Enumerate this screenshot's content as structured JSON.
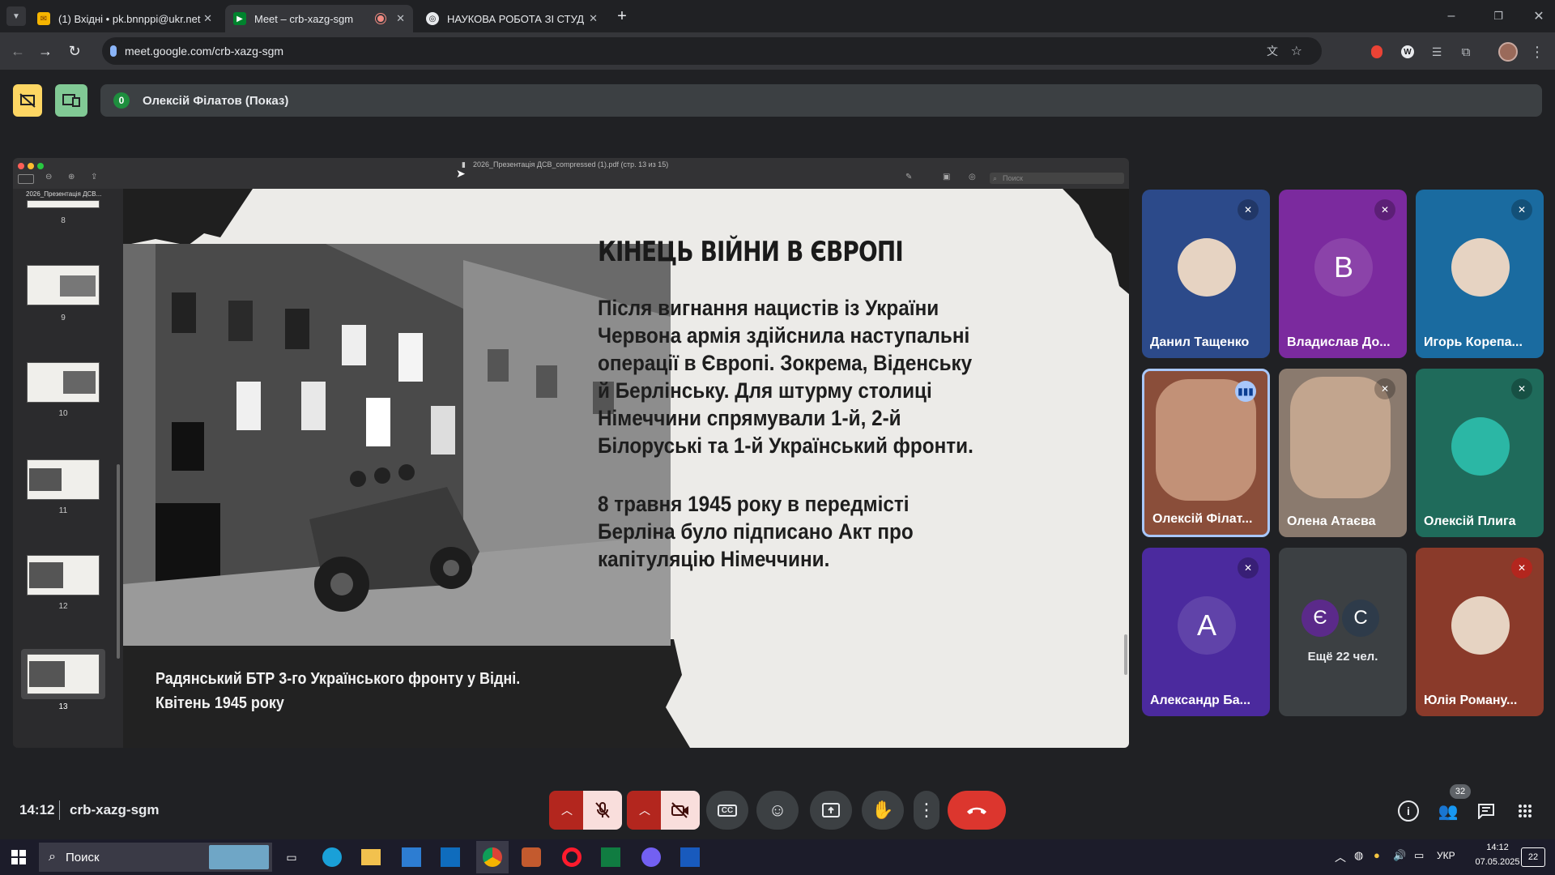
{
  "browser": {
    "tabs": [
      {
        "title": "(1) Вхідні • pk.bnnppi@ukr.net",
        "active": false
      },
      {
        "title": "Meet – crb-xazg-sgm",
        "active": true
      },
      {
        "title": "НАУКОВА РОБОТА ЗІ СТУДЕНТ",
        "active": false
      }
    ],
    "url": "meet.google.com/crb-xazg-sgm"
  },
  "meet": {
    "presenter_count": "0",
    "presenter_label": "Олексій Філатов (Показ)",
    "time": "14:12",
    "meeting_code": "crb-xazg-sgm",
    "participants_badge": "32"
  },
  "presentation": {
    "window_title": "2026_Презентація ДСВ_compressed (1).pdf (стр. 13 из 15)",
    "search_placeholder": "Поиск",
    "sidebar_label": "2026_Презентація ДСВ...",
    "thumb_pages": [
      "8",
      "9",
      "10",
      "11",
      "12",
      "13"
    ],
    "slide": {
      "heading": "КІНЕЦЬ ВІЙНИ В ЄВРОПІ",
      "paragraph1": "Після вигнання нацистів із України Червона армія здійснила наступальні операції в Європі. Зокрема, Віденську й Берлінську. Для штурму столиці Німеччини спрямували 1-й, 2-й Білоруські та 1-й Український фронти.",
      "paragraph2": "8 травня 1945 року в передмісті Берліна було підписано Акт про капітуляцію Німеччини.",
      "caption_line1": "Радянський БТР 3-го Українського фронту у Відні.",
      "caption_line2": "Квітень 1945 року"
    }
  },
  "participants": [
    {
      "name": "Данил Тащенко",
      "initial": "",
      "bg": "#2c4a8a"
    },
    {
      "name": "Владислав До...",
      "initial": "В",
      "bg": "#7b2a9e"
    },
    {
      "name": "Игорь Корепа...",
      "initial": "",
      "bg": "#1a6ba0"
    },
    {
      "name": "Олексій Філат...",
      "initial": "",
      "bg": "#8a4e3a"
    },
    {
      "name": "Олена Атаєва",
      "initial": "",
      "bg": "#8a7a6e"
    },
    {
      "name": "Олексій Плига",
      "initial": "",
      "bg": "#1f6b5b"
    },
    {
      "name": "Александр Ба...",
      "initial": "А",
      "bg": "#4b2a9e"
    },
    {
      "name": "Ещё 22 чел.",
      "initial": "",
      "bg": "#3c4043"
    },
    {
      "name": "Юлія Роману...",
      "initial": "",
      "bg": "#8a3a2a"
    }
  ],
  "more_initials": [
    "Є",
    "С"
  ],
  "taskbar": {
    "search": "Поиск",
    "lang": "УКР",
    "time": "14:12",
    "date": "07.05.2025",
    "notif": "22"
  }
}
